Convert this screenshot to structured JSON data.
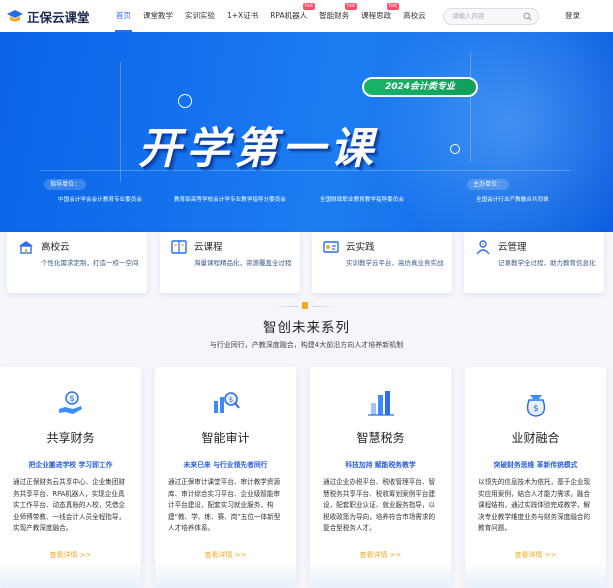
{
  "brand": {
    "name": "正保云课堂"
  },
  "nav": {
    "items": [
      {
        "label": "首页",
        "active": true
      },
      {
        "label": "课堂教学"
      },
      {
        "label": "实训实验"
      },
      {
        "label": "1+X证书"
      },
      {
        "label": "RPA机器人",
        "badge": "hot"
      },
      {
        "label": "智能财务",
        "badge": "hot"
      },
      {
        "label": "课程思政",
        "badge": "hot"
      },
      {
        "label": "高校云"
      }
    ],
    "search_placeholder": "请输入内容",
    "login": "登录"
  },
  "banner": {
    "tag": "2024会计类专业",
    "title": "开学第一课",
    "guide_label": "指导单位：",
    "host_label": "主办单位：",
    "orgs": [
      "中国会计学会会计教育专业委员会",
      "教育部高等学校会计学专业教学指导分委员会",
      "全国财政职业教育教学指导委员会",
      "全国会计行业产教融合共同体"
    ]
  },
  "features": [
    {
      "title": "高校云",
      "desc": "个性化需求定制，打造一校一空间",
      "icon": "school-cloud-icon"
    },
    {
      "title": "云课程",
      "desc": "海量课程精品化，资源覆盖全过程",
      "icon": "book-icon"
    },
    {
      "title": "云实践",
      "desc": "实训教学云平台，高仿真业务实战",
      "icon": "practice-icon"
    },
    {
      "title": "云管理",
      "desc": "记录教学全过程，助力教育信息化",
      "icon": "management-icon"
    }
  ],
  "section": {
    "title": "智创未来系列",
    "subtitle": "与行业同行，产教深度融合，构建4大前沿方向人才培养新机制"
  },
  "cards": [
    {
      "title": "共享财务",
      "slogan": "把企业搬进学校 学习即工作",
      "desc": "通过正保财务云共享中心、企业集团财务共享平台、RPA机器人，实现企业真实工作平台、动态真账的入校，凭借企业师傅带教、一线会计人员全程指导，实现产教深度融合。",
      "link": "查看详情 >>",
      "icon": "hand-coin-icon"
    },
    {
      "title": "智能审计",
      "slogan": "未来已来 与行业领先者同行",
      "desc": "通过正保审计课堂平台、审计教学资源库、审计综合实习平台、企业级智能审计平台建设，配套实习就业服务，构建“教、学、练、赛、岗”五位一体新型人才培养体系。",
      "link": "查看详情 >>",
      "icon": "magnifier-chart-icon"
    },
    {
      "title": "智慧税务",
      "slogan": "科技加持 赋能税务教学",
      "desc": "通过企业办税平台、税收管理平台、智慧税务共享平台、税收筹划案例平台建设，配套职业认证、就业服务指导，以税收政策为导向，培养符合市场需求的复合型税务人才。",
      "link": "查看详情 >>",
      "icon": "tax-bars-icon"
    },
    {
      "title": "业财融合",
      "slogan": "突破财务思维 革新传统模式",
      "desc": "以领先的信息技术为依托，基于企业现实应用案例，结合人才能力需求，融合课程结构，通过实践体验完成教学，解决专业教学维度业务与财务深度融合的教育问题。",
      "link": "查看详情 >>",
      "icon": "bag-coin-icon"
    }
  ],
  "colors": {
    "primary": "#2b6ef0",
    "accent": "#f2a922",
    "hot": "#ff4d6a",
    "banner": "#1c7df2"
  }
}
